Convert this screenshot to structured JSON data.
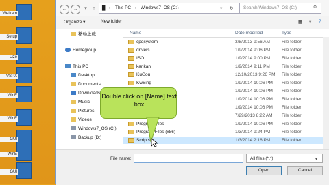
{
  "desktop": {
    "icons": [
      {
        "label": "Welkam"
      },
      {
        "label": "Setup"
      },
      {
        "label": "Lize"
      },
      {
        "label": "VSPX"
      },
      {
        "label": "WinE"
      },
      {
        "label": "WinE"
      },
      {
        "label": "GUI"
      },
      {
        "label": "WinE"
      },
      {
        "label": "GUI"
      }
    ]
  },
  "dialog": {
    "address": {
      "segments": [
        "This PC",
        "Windows7_OS (C:)"
      ],
      "search_placeholder": "Search Windows7_OS (C:)"
    },
    "toolbar": {
      "organize_label": "Organize ▾",
      "new_folder_label": "New folder"
    },
    "nav_pane": {
      "items": [
        {
          "label": "移动上载",
          "icon": "folder-icon"
        },
        {
          "label": "Homegroup",
          "icon": "homegroup-icon"
        },
        {
          "label": "This PC",
          "icon": "computer-icon"
        },
        {
          "label": "Desktop",
          "icon": "desktop-icon"
        },
        {
          "label": "Documents",
          "icon": "documents-icon"
        },
        {
          "label": "Downloads",
          "icon": "downloads-icon"
        },
        {
          "label": "Music",
          "icon": "music-icon"
        },
        {
          "label": "Pictures",
          "icon": "pictures-icon"
        },
        {
          "label": "Videos",
          "icon": "videos-icon"
        },
        {
          "label": "Windows7_OS (C:)",
          "icon": "drive-icon"
        },
        {
          "label": "Backup (D:)",
          "icon": "drive-icon"
        }
      ]
    },
    "file_list": {
      "columns": {
        "name": "Name",
        "date": "Date modified",
        "type": "Type"
      },
      "rows": [
        {
          "name": "cpqsystem",
          "date": "3/8/2013 9:56 AM",
          "type": "File folder"
        },
        {
          "name": "drivers",
          "date": "1/9/2014 9:06 PM",
          "type": "File folder"
        },
        {
          "name": "ISO",
          "date": "1/9/2014 9:00 PM",
          "type": "File folder"
        },
        {
          "name": "kankan",
          "date": "1/9/2014 9:11 PM",
          "type": "File folder"
        },
        {
          "name": "KuGou",
          "date": "12/10/2013 9:26 PM",
          "type": "File folder"
        },
        {
          "name": "KwSing",
          "date": "1/9/2014 10:06 PM",
          "type": "File folder"
        },
        {
          "name": "Idiag",
          "date": "1/9/2014 10:06 PM",
          "type": "File folder"
        },
        {
          "name": "Microsoft",
          "date": "1/9/2014 10:06 PM",
          "type": "File folder"
        },
        {
          "name": "Microsoft",
          "date": "1/9/2014 10:06 PM",
          "type": "File folder"
        },
        {
          "name": "PerfLogs",
          "date": "7/29/2013 8:22 AM",
          "type": "File folder"
        },
        {
          "name": "Program Files",
          "date": "1/9/2014 10:06 PM",
          "type": "File folder"
        },
        {
          "name": "Program Files (x86)",
          "date": "1/3/2014 9:24 PM",
          "type": "File folder"
        },
        {
          "name": "Scripts",
          "date": "1/3/2014 2:16 PM",
          "type": "File folder"
        }
      ]
    },
    "bottom": {
      "filename_label": "File name:",
      "filename_value": "",
      "filetype_value": "All files (*.*)",
      "open_label": "Open",
      "cancel_label": "Cancel"
    }
  },
  "callout": {
    "text_line1": "Double click on [Name] text",
    "text_line2": "box"
  }
}
